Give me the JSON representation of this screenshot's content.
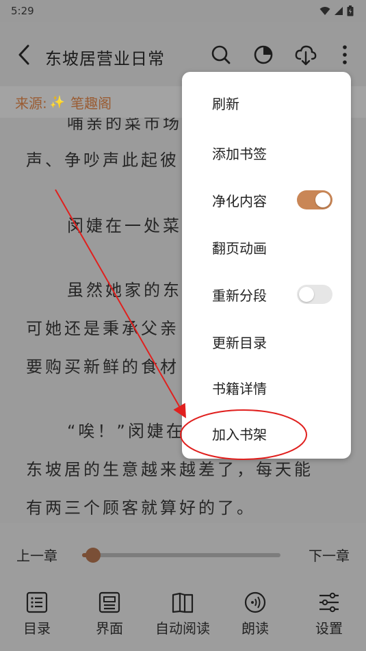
{
  "status_bar": {
    "time": "5:29"
  },
  "header": {
    "title": "东坡居营业日常"
  },
  "source": {
    "label": "来源:",
    "name": "笔趣阁"
  },
  "reading": {
    "lines": [
      "哺亲的菜市场",
      "声、争吵声此起彼",
      "闵婕在一处菜",
      "虽然她家的东",
      "可她还是秉承父亲",
      "要购买新鲜的食材",
      "“唉！”闵婕在",
      "东坡居的生意越来越差了，每天能",
      "有两三个顾客就算好的了。"
    ]
  },
  "menu": {
    "items": [
      {
        "label": "刷新"
      },
      {
        "label": "添加书签"
      },
      {
        "label": "净化内容",
        "toggle": true
      },
      {
        "label": "翻页动画"
      },
      {
        "label": "重新分段",
        "toggle": false
      },
      {
        "label": "更新目录"
      },
      {
        "label": "书籍详情"
      },
      {
        "label": "加入书架"
      }
    ]
  },
  "chapter_nav": {
    "prev": "上一章",
    "next": "下一章",
    "progress": 0.03
  },
  "toolbar": {
    "items": [
      {
        "label": "目录",
        "icon": "catalog-icon"
      },
      {
        "label": "界面",
        "icon": "interface-icon"
      },
      {
        "label": "自动阅读",
        "icon": "auto-read-icon"
      },
      {
        "label": "朗读",
        "icon": "read-aloud-icon"
      },
      {
        "label": "设置",
        "icon": "settings-icon"
      }
    ]
  },
  "colors": {
    "accent": "#c98656",
    "source_text": "#9a5c33",
    "annotation": "#e0201e"
  }
}
